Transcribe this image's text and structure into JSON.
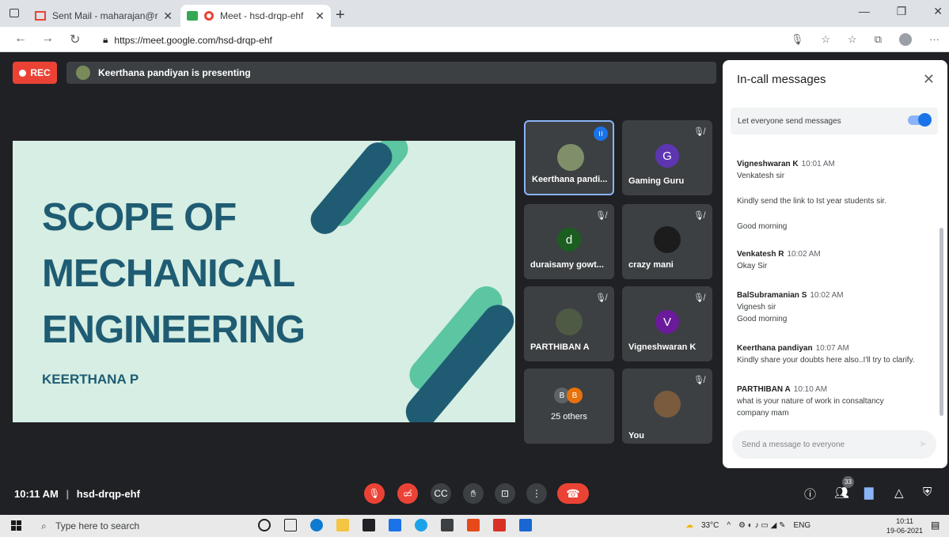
{
  "browser": {
    "tabs": [
      {
        "title": "Sent Mail - maharajan@ritrjpm.a",
        "active": false
      },
      {
        "title": "Meet - hsd-drqp-ehf",
        "active": true
      }
    ],
    "url": "https://meet.google.com/hsd-drqp-ehf"
  },
  "meet": {
    "rec_label": "REC",
    "presenting": "Keerthana pandiyan is presenting",
    "slide": {
      "title_lines": [
        "SCOPE OF",
        "MECHANICAL",
        "ENGINEERING"
      ],
      "author": "KEERTHANA P"
    },
    "tiles": [
      {
        "name": "Keerthana pandi...",
        "kind": "photo",
        "speaking": true
      },
      {
        "name": "Gaming Guru",
        "kind": "letter",
        "letter": "G",
        "color": "#5e35b1"
      },
      {
        "name": "duraisamy gowt...",
        "kind": "letter",
        "letter": "d",
        "color": "#1b5e20"
      },
      {
        "name": "crazy mani",
        "kind": "photo"
      },
      {
        "name": "PARTHIBAN A",
        "kind": "photo"
      },
      {
        "name": "Vigneshwaran K",
        "kind": "letter",
        "letter": "V",
        "color": "#6a1b9a"
      },
      {
        "name": "25 others",
        "kind": "group",
        "letters": [
          "B",
          "B"
        ]
      },
      {
        "name": "You",
        "kind": "photo"
      }
    ],
    "meeting_time": "10:11 AM",
    "meeting_code": "hsd-drqp-ehf",
    "participant_count": "33"
  },
  "chat": {
    "title": "In-call messages",
    "allow_label": "Let everyone send messages",
    "messages": [
      {
        "sender": "Vigneshwaran K",
        "time": "10:01 AM",
        "lines": [
          "Venkatesh sir"
        ]
      },
      {
        "sender": "",
        "time": "",
        "lines": [
          "Kindly send the link to Ist year students sir."
        ]
      },
      {
        "sender": "",
        "time": "",
        "lines": [
          "Good morning"
        ]
      },
      {
        "sender": "Venkatesh R",
        "time": "10:02 AM",
        "lines": [
          "Okay Sir"
        ]
      },
      {
        "sender": "BalSubramanian S",
        "time": "10:02 AM",
        "lines": [
          "Vignesh sir",
          "Good morning"
        ]
      },
      {
        "sender": "Keerthana pandiyan",
        "time": "10:07 AM",
        "lines": [
          "Kindly share your doubts here also..I'll try to clarify."
        ]
      },
      {
        "sender": "PARTHIBAN A",
        "time": "10:10 AM",
        "lines": [
          "what is your nature of work  in consaltancy",
          "company mam"
        ]
      }
    ],
    "input_placeholder": "Send a message to everyone"
  },
  "taskbar": {
    "search_placeholder": "Type here to search",
    "weather": "33°C",
    "lang": "ENG",
    "time": "10:11",
    "date": "19-06-2021"
  }
}
